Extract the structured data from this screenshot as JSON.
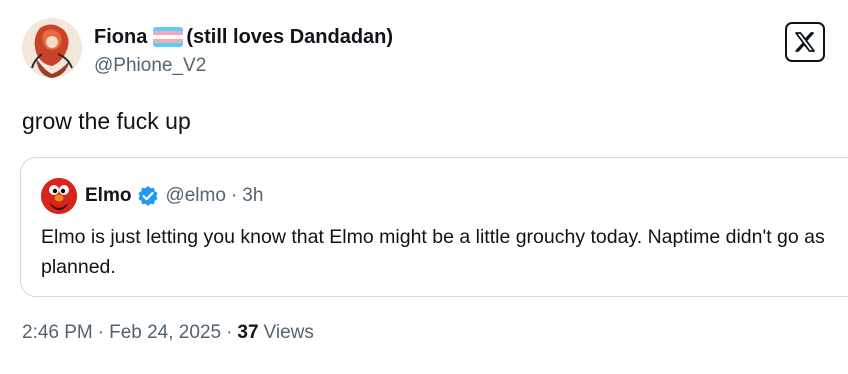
{
  "post": {
    "author": {
      "display_name": "Fiona",
      "display_suffix": "(still loves Dandadan)",
      "handle": "@Phione_V2",
      "flag_colors": [
        "#5BCEFA",
        "#F5A9B8",
        "#FFFFFF",
        "#F5A9B8",
        "#5BCEFA"
      ]
    },
    "text": "grow the fuck up",
    "time": "2:46 PM",
    "date": "Feb 24, 2025",
    "separator": "·",
    "views_count": "37",
    "views_label": "Views"
  },
  "quoted": {
    "name": "Elmo",
    "handle": "@elmo",
    "separator": "·",
    "time": "3h",
    "text": "Elmo is just letting you know that Elmo might be a little grouchy today. Naptime didn't go as planned.",
    "verified_color": "#1d9bf0"
  },
  "icons": {
    "x_logo": "x-logo-icon",
    "more": "chevron-down-icon"
  }
}
